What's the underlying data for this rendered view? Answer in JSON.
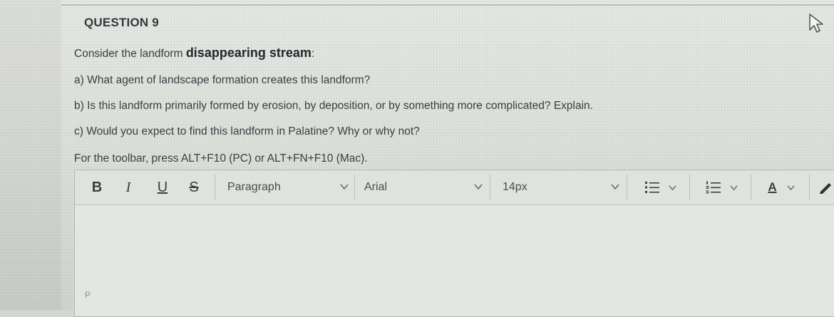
{
  "question": {
    "title": "QUESTION 9",
    "intro_prefix": "Consider the landform ",
    "intro_term": "disappearing stream",
    "intro_suffix": ":",
    "part_a": "a) What agent of landscape formation creates this landform?",
    "part_b": "b) Is this landform primarily formed by erosion, by deposition, or by something more complicated? Explain.",
    "part_c": "c) Would you expect to find this landform in Palatine? Why or why not?",
    "toolbar_hint": "For the toolbar, press ALT+F10 (PC) or ALT+FN+F10 (Mac)."
  },
  "toolbar": {
    "bold": "B",
    "italic": "I",
    "underline": "U",
    "strike": "S",
    "paragraph_format": "Paragraph",
    "font_family": "Arial",
    "font_size": "14px",
    "text_color_label": "A"
  },
  "editor": {
    "body_text": "",
    "status_path": "P"
  },
  "icons": [
    "cursor-arrow-icon",
    "chevron-down-icon",
    "unordered-list-icon",
    "ordered-list-icon",
    "text-color-icon",
    "pencil-icon"
  ]
}
